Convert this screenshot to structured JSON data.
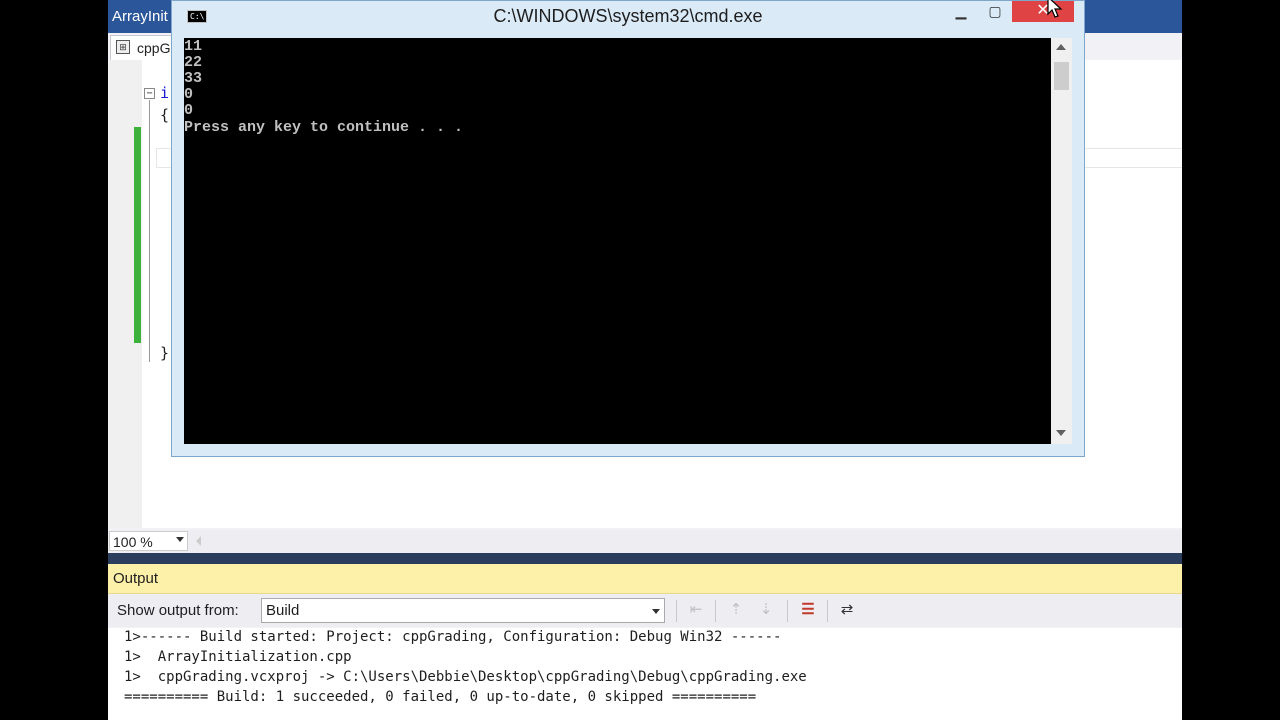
{
  "ide": {
    "title": "ArrayInit",
    "doc_tab": "cppG",
    "code_fragments": {
      "line1": "i",
      "line2": "{",
      "line3": "}"
    },
    "zoom": {
      "value": "100 %"
    }
  },
  "output": {
    "title": "Output",
    "show_output_from_label": "Show output from:",
    "source": "Build",
    "lines": [
      "1>------ Build started: Project: cppGrading, Configuration: Debug Win32 ------",
      "1>  ArrayInitialization.cpp",
      "1>  cppGrading.vcxproj -> C:\\Users\\Debbie\\Desktop\\cppGrading\\Debug\\cppGrading.exe",
      "========== Build: 1 succeeded, 0 failed, 0 up-to-date, 0 skipped =========="
    ]
  },
  "cmd": {
    "title": "C:\\WINDOWS\\system32\\cmd.exe",
    "icon_text": "C:\\",
    "console_lines": [
      "11",
      "22",
      "33",
      "0",
      "0",
      "Press any key to continue . . ."
    ]
  },
  "colors": {
    "ide_accent": "#2b579a",
    "output_header": "#fdf0a8",
    "close_button": "#e04343",
    "change_bar": "#3cb13c"
  },
  "icons": {
    "minimize": "minimize-icon",
    "maximize": "maximize-icon",
    "close": "close-icon",
    "clear_all": "clear-all-icon",
    "word_wrap": "word-wrap-icon"
  }
}
